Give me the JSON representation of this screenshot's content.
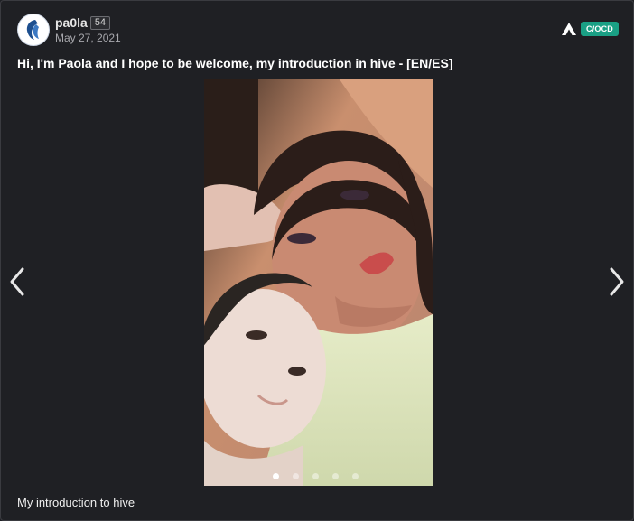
{
  "post": {
    "author": "pa0la",
    "reputation": "54",
    "date": "May 27, 2021",
    "title": "Hi, I'm Paola and I hope to be welcome, my introduction in hive - [EN/ES]",
    "caption": "My introduction to hive"
  },
  "community": {
    "badge": "C/OCD",
    "badge_color": "#1aa085"
  },
  "carousel": {
    "total_slides": 5,
    "active_index": 0,
    "prev_icon": "chevron-left-icon",
    "next_icon": "chevron-right-icon"
  }
}
